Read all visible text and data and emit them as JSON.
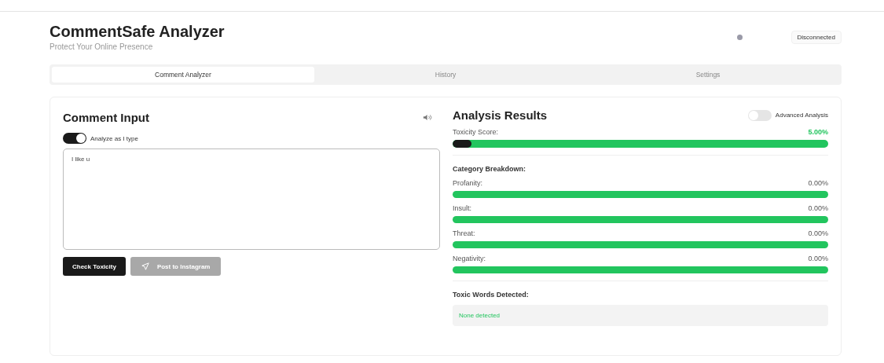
{
  "header": {
    "title": "CommentSafe Analyzer",
    "subtitle": "Protect Your Online Presence",
    "status": {
      "label": "Disconnected",
      "connected": false
    }
  },
  "tabs": [
    {
      "label": "Comment Analyzer",
      "selected": true
    },
    {
      "label": "History",
      "selected": false
    },
    {
      "label": "Settings",
      "selected": false
    }
  ],
  "input_panel": {
    "title": "Comment Input",
    "analyze_as_type": {
      "label": "Analyze as I type",
      "on": true
    },
    "comment": {
      "value": "I like u"
    },
    "buttons": [
      {
        "label": "Check Toxicity",
        "kind": "primary",
        "disabled": false
      },
      {
        "label": "Post to Instagram",
        "kind": "send",
        "disabled": true
      }
    ]
  },
  "results": {
    "title": "Analysis Results",
    "advanced": {
      "label": "Advanced Analysis",
      "on": false
    },
    "toxicity": {
      "label": "Toxicity Score:",
      "reading": "5.00%",
      "level": 0.05
    },
    "breakdown_title": "Category Breakdown:",
    "categories": [
      {
        "name": "Profanity:",
        "reading": "0.00%"
      },
      {
        "name": "Insult:",
        "reading": "0.00%"
      },
      {
        "name": "Threat:",
        "reading": "0.00%"
      },
      {
        "name": "Negativity:",
        "reading": "0.00%"
      }
    ],
    "toxic_words_title": "Toxic Words Detected:",
    "toxic_words": {
      "text": "None detected"
    }
  }
}
